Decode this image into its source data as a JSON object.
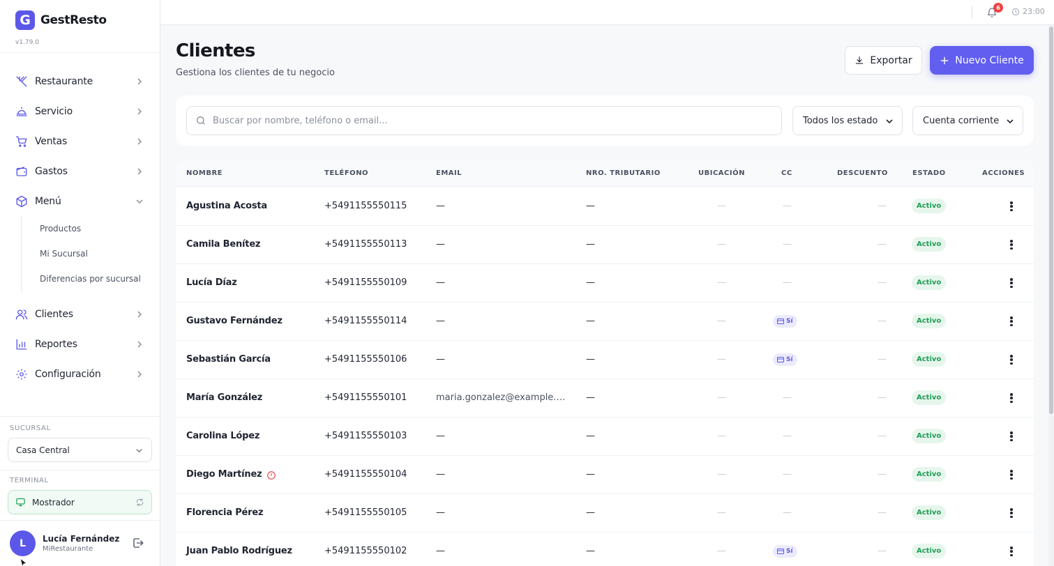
{
  "app": {
    "name": "GestResto",
    "logo_letter": "G",
    "version": "v1.79.0"
  },
  "nav": {
    "items": [
      {
        "label": "Restaurante",
        "icon": "utensils-icon"
      },
      {
        "label": "Servicio",
        "icon": "service-bell-icon"
      },
      {
        "label": "Ventas",
        "icon": "cart-icon"
      },
      {
        "label": "Gastos",
        "icon": "wallet-icon"
      },
      {
        "label": "Menú",
        "icon": "package-icon"
      },
      {
        "label": "Clientes",
        "icon": "users-icon"
      },
      {
        "label": "Reportes",
        "icon": "bar-chart-icon"
      },
      {
        "label": "Configuración",
        "icon": "gear-icon"
      }
    ],
    "submenu": [
      "Productos",
      "Mi Sucursal",
      "Diferencias por sucursal"
    ]
  },
  "branch": {
    "label": "SUCURSAL",
    "value": "Casa Central"
  },
  "terminal": {
    "label": "TERMINAL",
    "value": "Mostrador"
  },
  "user": {
    "initial": "L",
    "name": "Lucía Fernández",
    "org": "MiRestaurante"
  },
  "topbar": {
    "notifications": "6",
    "time": "23:00"
  },
  "page": {
    "title": "Clientes",
    "subtitle": "Gestiona los clientes de tu negocio",
    "export_label": "Exportar",
    "new_label": "Nuevo Cliente"
  },
  "filters": {
    "search_placeholder": "Buscar por nombre, teléfono o email...",
    "status": "Todos los estado",
    "account": "Cuenta corriente"
  },
  "table": {
    "headers": [
      "NOMBRE",
      "TELÉFONO",
      "EMAIL",
      "NRO. TRIBUTARIO",
      "UBICACIÓN",
      "CC",
      "DESCUENTO",
      "ESTADO",
      "ACCIONES"
    ],
    "rows": [
      {
        "name": "Agustina Acosta",
        "phone": "+5491155550115",
        "email": "—",
        "tax": "—",
        "location": "—",
        "cc": "—",
        "discount": "—",
        "status": "Activo"
      },
      {
        "name": "Camila Benítez",
        "phone": "+5491155550113",
        "email": "—",
        "tax": "—",
        "location": "—",
        "cc": "—",
        "discount": "—",
        "status": "Activo"
      },
      {
        "name": "Lucía Díaz",
        "phone": "+5491155550109",
        "email": "—",
        "tax": "—",
        "location": "—",
        "cc": "—",
        "discount": "—",
        "status": "Activo"
      },
      {
        "name": "Gustavo Fernández",
        "phone": "+5491155550114",
        "email": "—",
        "tax": "—",
        "location": "—",
        "cc": "Sí",
        "discount": "—",
        "status": "Activo"
      },
      {
        "name": "Sebastián García",
        "phone": "+5491155550106",
        "email": "—",
        "tax": "—",
        "location": "—",
        "cc": "Sí",
        "discount": "—",
        "status": "Activo"
      },
      {
        "name": "María González",
        "phone": "+5491155550101",
        "email": "maria.gonzalez@example.c...",
        "tax": "—",
        "location": "—",
        "cc": "—",
        "discount": "—",
        "status": "Activo"
      },
      {
        "name": "Carolina López",
        "phone": "+5491155550103",
        "email": "—",
        "tax": "—",
        "location": "—",
        "cc": "—",
        "discount": "—",
        "status": "Activo"
      },
      {
        "name": "Diego Martínez",
        "phone": "+5491155550104",
        "email": "—",
        "tax": "—",
        "location": "—",
        "cc": "—",
        "discount": "—",
        "status": "Activo"
      },
      {
        "name": "Florencia Pérez",
        "phone": "+5491155550105",
        "email": "—",
        "tax": "—",
        "location": "—",
        "cc": "—",
        "discount": "—",
        "status": "Activo"
      },
      {
        "name": "Juan Pablo Rodríguez",
        "phone": "+5491155550102",
        "email": "—",
        "tax": "—",
        "location": "—",
        "cc": "Sí",
        "discount": "—",
        "status": "Activo"
      }
    ]
  },
  "colors": {
    "accent": "#615ef0",
    "active_green": "#1f9d55",
    "alert_red": "#ef4444"
  }
}
